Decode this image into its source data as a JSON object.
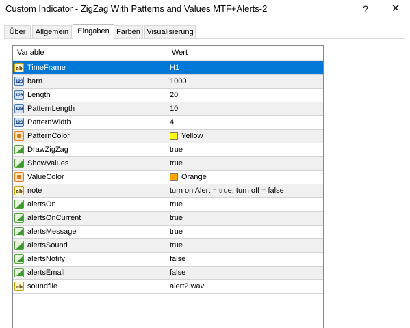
{
  "window": {
    "title": "Custom Indicator - ZigZag With Patterns and Values MTF+Alerts-2",
    "help_glyph": "?",
    "close_glyph": "✕"
  },
  "tabs": [
    {
      "label": "Über",
      "active": false
    },
    {
      "label": "Allgemein",
      "active": false
    },
    {
      "label": "Eingaben",
      "active": true
    },
    {
      "label": "Farben",
      "active": false
    },
    {
      "label": "Visualisierung",
      "active": false
    }
  ],
  "grid": {
    "col_variable": "Variable",
    "col_value": "Wert"
  },
  "icon_glyphs": {
    "string": "ab",
    "int": "123"
  },
  "rows": [
    {
      "variable": "TimeFrame",
      "value": "H1",
      "type": "string",
      "icon": "string-type-icon",
      "selected": true
    },
    {
      "variable": "barn",
      "value": "1000",
      "type": "int",
      "icon": "integer-type-icon"
    },
    {
      "variable": "Length",
      "value": "20",
      "type": "int",
      "icon": "integer-type-icon"
    },
    {
      "variable": "PatternLength",
      "value": "10",
      "type": "int",
      "icon": "integer-type-icon"
    },
    {
      "variable": "PatternWidth",
      "value": "4",
      "type": "int",
      "icon": "integer-type-icon"
    },
    {
      "variable": "PatternColor",
      "value": "Yellow",
      "type": "color",
      "icon": "color-type-icon",
      "swatch": "#ffff00"
    },
    {
      "variable": "DrawZigZag",
      "value": "true",
      "type": "bool",
      "icon": "boolean-type-icon"
    },
    {
      "variable": "ShowValues",
      "value": "true",
      "type": "bool",
      "icon": "boolean-type-icon"
    },
    {
      "variable": "ValueColor",
      "value": "Orange",
      "type": "color",
      "icon": "color-type-icon",
      "swatch": "#ffa500"
    },
    {
      "variable": "note",
      "value": "turn on Alert = true; turn off = false",
      "type": "string",
      "icon": "string-type-icon"
    },
    {
      "variable": "alertsOn",
      "value": "true",
      "type": "bool",
      "icon": "boolean-type-icon"
    },
    {
      "variable": "alertsOnCurrent",
      "value": "true",
      "type": "bool",
      "icon": "boolean-type-icon"
    },
    {
      "variable": "alertsMessage",
      "value": "true",
      "type": "bool",
      "icon": "boolean-type-icon"
    },
    {
      "variable": "alertsSound",
      "value": "true",
      "type": "bool",
      "icon": "boolean-type-icon"
    },
    {
      "variable": "alertsNotify",
      "value": "false",
      "type": "bool",
      "icon": "boolean-type-icon"
    },
    {
      "variable": "alertsEmail",
      "value": "false",
      "type": "bool",
      "icon": "boolean-type-icon"
    },
    {
      "variable": "soundfile",
      "value": "alert2.wav",
      "type": "string",
      "icon": "string-type-icon"
    }
  ],
  "colors": {
    "selection": "#0078d7",
    "alt_row": "#f0f0f0"
  }
}
